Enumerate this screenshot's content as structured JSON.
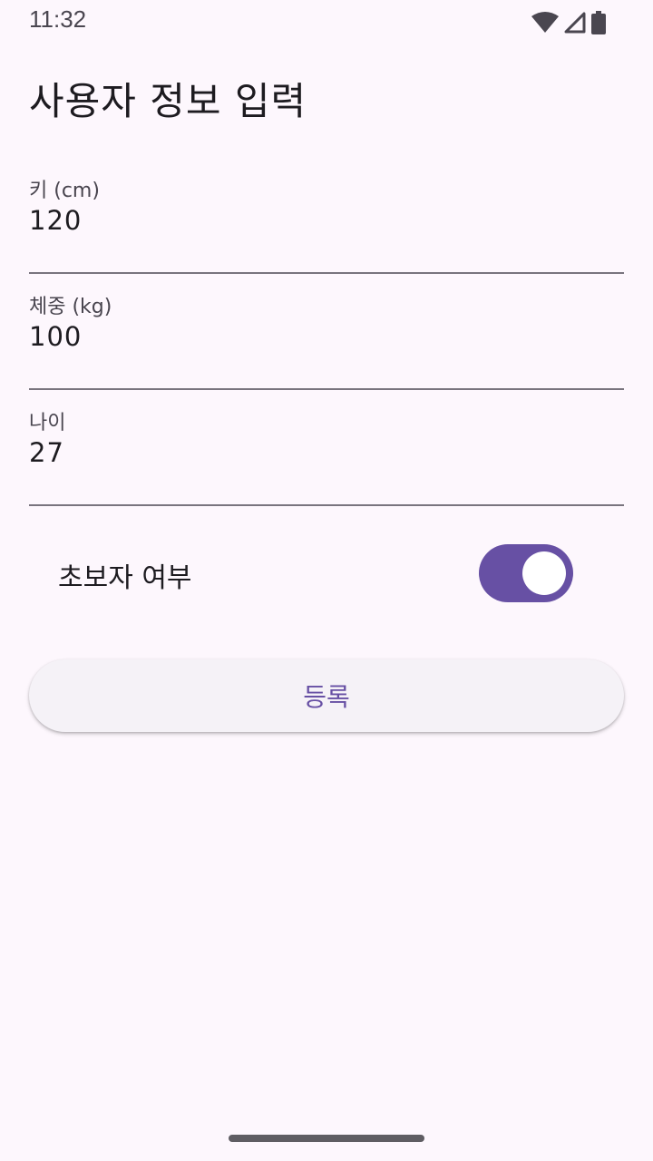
{
  "status_bar": {
    "time": "11:32",
    "icons": [
      "wifi-icon",
      "cell-signal-icon",
      "battery-icon"
    ]
  },
  "page": {
    "title": "사용자 정보 입력"
  },
  "form": {
    "fields": [
      {
        "label": "키 (cm)",
        "value": "120"
      },
      {
        "label": "체중 (kg)",
        "value": "100"
      },
      {
        "label": "나이",
        "value": "27"
      }
    ],
    "beginner_switch": {
      "label": "초보자 여부",
      "checked": true
    },
    "submit_label": "등록"
  },
  "colors": {
    "background": "#fdf7fd",
    "accent": "#6750a4",
    "button_bg": "#f5f2f7",
    "underline": "#79747e"
  }
}
